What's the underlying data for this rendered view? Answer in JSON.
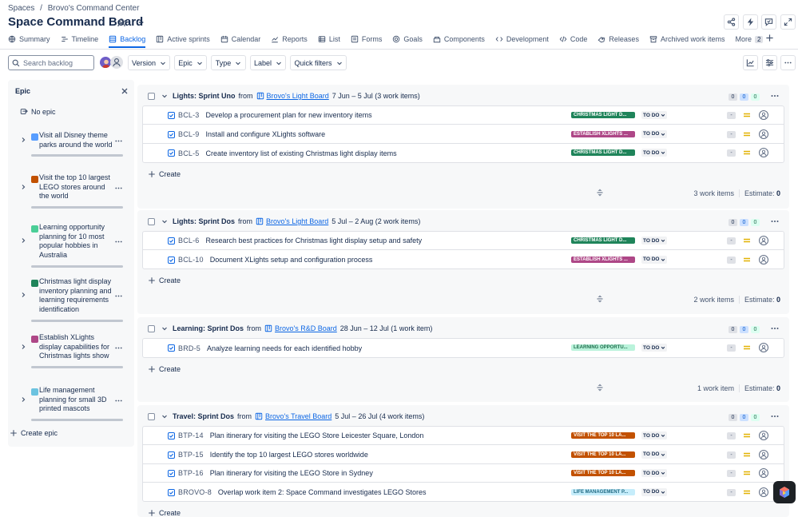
{
  "breadcrumb": {
    "root": "Spaces",
    "separator": "/",
    "current": "Brovo's Command Center"
  },
  "page_title": "Space Command Board",
  "tabs": [
    {
      "label": "Summary",
      "icon": "globe-icon"
    },
    {
      "label": "Timeline",
      "icon": "timeline-icon"
    },
    {
      "label": "Backlog",
      "icon": "backlog-icon",
      "active": true
    },
    {
      "label": "Active sprints",
      "icon": "board-icon"
    },
    {
      "label": "Calendar",
      "icon": "calendar-icon"
    },
    {
      "label": "Reports",
      "icon": "reports-icon"
    },
    {
      "label": "List",
      "icon": "list-icon"
    },
    {
      "label": "Forms",
      "icon": "forms-icon"
    },
    {
      "label": "Goals",
      "icon": "goals-icon"
    },
    {
      "label": "Components",
      "icon": "components-icon"
    },
    {
      "label": "Development",
      "icon": "development-icon"
    },
    {
      "label": "Code",
      "icon": "code-icon"
    },
    {
      "label": "Releases",
      "icon": "releases-icon"
    },
    {
      "label": "Archived work items",
      "icon": "archive-icon"
    },
    {
      "label": "More",
      "icon": "",
      "count": "2"
    }
  ],
  "search": {
    "placeholder": "Search backlog"
  },
  "filters": {
    "version": "Version",
    "epic": "Epic",
    "type": "Type",
    "label": "Label",
    "quick": "Quick filters"
  },
  "epic_panel": {
    "title": "Epic",
    "no_epic": "No epic",
    "create": "Create epic",
    "epics": [
      {
        "name": "Visit all Disney theme parks around the world",
        "color": "#579dff"
      },
      {
        "name": "Visit the top 10 largest LEGO stores around the world",
        "color": "#c25100"
      },
      {
        "name": "Learning opportunity planning for 10 most popular hobbies in Australia",
        "color": "#4bce97"
      },
      {
        "name": "Christmas light display inventory planning and learning requirements identification",
        "color": "#1f845a"
      },
      {
        "name": "Establish XLights display capabilities for Christmas lights show",
        "color": "#ae4787"
      },
      {
        "name": "Life management planning for small 3D printed mascots",
        "color": "#6cc3e0"
      }
    ]
  },
  "sprints": [
    {
      "name": "Lights: Sprint Uno",
      "from": "from",
      "board": "Brovo's Light Board",
      "dates": "7 Jun – 5 Jul (3 work items)",
      "counts": [
        "0",
        "0",
        "0"
      ],
      "create": "Create",
      "footer_items": "3 work items",
      "estimate_label": "Estimate:",
      "estimate": "0",
      "issues": [
        {
          "key": "BCL-3",
          "summary": "Develop a procurement plan for new inventory items",
          "epic": "CHRISTMAS LIGHT D...",
          "epic_bg": "#1f845a",
          "epic_fg": "#ffffff",
          "status": "TO DO",
          "est": "-"
        },
        {
          "key": "BCL-9",
          "summary": "Install and configure XLights software",
          "epic": "ESTABLISH XLIGHTS ...",
          "epic_bg": "#ae4787",
          "epic_fg": "#ffffff",
          "status": "TO DO",
          "est": "-"
        },
        {
          "key": "BCL-5",
          "summary": "Create inventory list of existing Christmas light display items",
          "epic": "CHRISTMAS LIGHT D...",
          "epic_bg": "#1f845a",
          "epic_fg": "#ffffff",
          "status": "TO DO",
          "est": "-"
        }
      ]
    },
    {
      "name": "Lights: Sprint Dos",
      "from": "from",
      "board": "Brovo's Light Board",
      "dates": "5 Jul – 2 Aug (2 work items)",
      "counts": [
        "0",
        "0",
        "0"
      ],
      "create": "Create",
      "footer_items": "2 work items",
      "estimate_label": "Estimate:",
      "estimate": "0",
      "issues": [
        {
          "key": "BCL-6",
          "summary": "Research best practices for Christmas light display setup and safety",
          "epic": "CHRISTMAS LIGHT D...",
          "epic_bg": "#1f845a",
          "epic_fg": "#ffffff",
          "status": "TO DO",
          "est": "-"
        },
        {
          "key": "BCL-10",
          "summary": "Document XLights setup and configuration process",
          "epic": "ESTABLISH XLIGHTS ...",
          "epic_bg": "#ae4787",
          "epic_fg": "#ffffff",
          "status": "TO DO",
          "est": "-"
        }
      ]
    },
    {
      "name": "Learning: Sprint Dos",
      "from": "from",
      "board": "Brovo's R&D Board",
      "dates": "28 Jun – 12 Jul (1 work item)",
      "counts": [
        "0",
        "0",
        "0"
      ],
      "create": "Create",
      "footer_items": "1 work item",
      "estimate_label": "Estimate:",
      "estimate": "0",
      "issues": [
        {
          "key": "BRD-5",
          "summary": "Analyze learning needs for each identified hobby",
          "epic": "LEARNING OPPORTU...",
          "epic_bg": "#baf3db",
          "epic_fg": "#216e4e",
          "status": "TO DO",
          "est": "-"
        }
      ]
    },
    {
      "name": "Travel: Sprint Dos",
      "from": "from",
      "board": "Brovo's Travel Board",
      "dates": "5 Jul – 26 Jul (4 work items)",
      "counts": [
        "0",
        "0",
        "0"
      ],
      "create": "Create",
      "issues": [
        {
          "key": "BTP-14",
          "summary": "Plan itinerary for visiting the LEGO Store Leicester Square, London",
          "epic": "VISIT THE TOP 10 LA...",
          "epic_bg": "#c25100",
          "epic_fg": "#ffffff",
          "status": "TO DO",
          "est": "-"
        },
        {
          "key": "BTP-15",
          "summary": "Identify the top 10 largest LEGO stores worldwide",
          "epic": "VISIT THE TOP 10 LA...",
          "epic_bg": "#c25100",
          "epic_fg": "#ffffff",
          "status": "TO DO",
          "est": "-"
        },
        {
          "key": "BTP-16",
          "summary": "Plan itinerary for visiting the LEGO Store in Sydney",
          "epic": "VISIT THE TOP 10 LA...",
          "epic_bg": "#c25100",
          "epic_fg": "#ffffff",
          "status": "TO DO",
          "est": "-"
        },
        {
          "key": "BROVO-8",
          "summary": "Overlap work item 2: Space Command investigates LEGO Stores",
          "epic": "LIFE MANAGEMENT P...",
          "epic_bg": "#c6edfb",
          "epic_fg": "#206a83",
          "status": "TO DO",
          "est": "-"
        }
      ]
    }
  ],
  "colors": {
    "accent": "#0c66e4",
    "text": "#172b4d",
    "subtle": "#44546f",
    "panel": "#f7f8f9"
  }
}
